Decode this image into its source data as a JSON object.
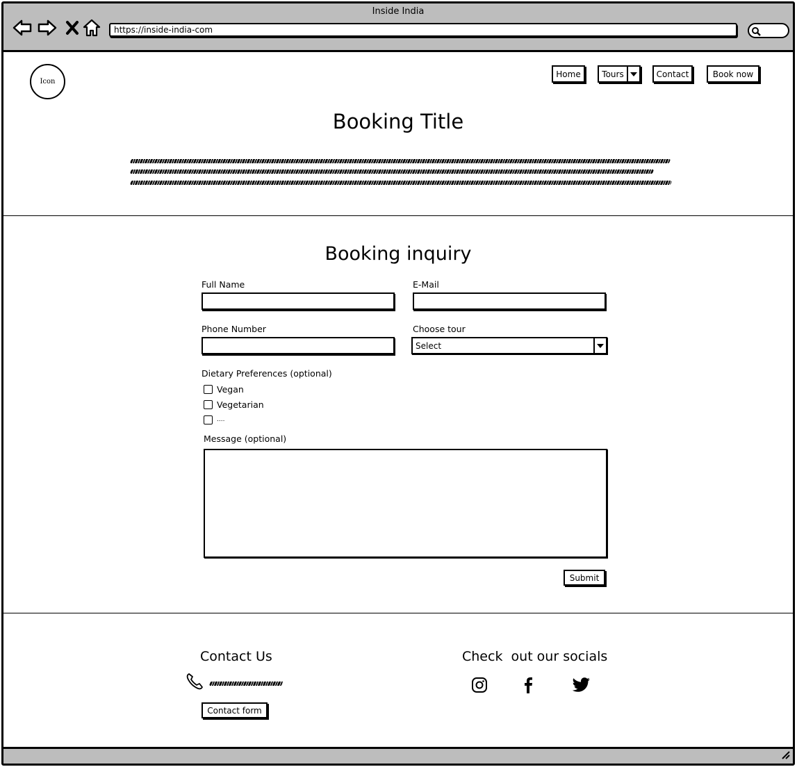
{
  "browser": {
    "title": "Inside India",
    "url": "https://inside-india-com",
    "icons": [
      "back-arrow-icon",
      "forward-arrow-icon",
      "close-x-icon",
      "home-icon",
      "search-icon"
    ]
  },
  "header": {
    "logo_label": "Icon",
    "nav": {
      "home": "Home",
      "tours": "Tours",
      "contact": "Contact",
      "book_now": "Book now"
    }
  },
  "hero": {
    "title": "Booking Title"
  },
  "form": {
    "heading": "Booking inquiry",
    "full_name_label": "Full Name",
    "email_label": "E-Mail",
    "phone_label": "Phone Number",
    "tour_label": "Choose tour",
    "tour_selected": "Select",
    "dietary_label": "Dietary Preferences (optional)",
    "dietary_options": [
      "Vegan",
      "Vegetarian",
      "...."
    ],
    "message_label": "Message (optional)",
    "submit_label": "Submit"
  },
  "footer": {
    "contact_heading": "Contact Us",
    "contact_button": "Contact form",
    "socials_heading": "Check  out our socials",
    "social_icons": [
      "instagram-icon",
      "facebook-icon",
      "twitter-icon"
    ]
  },
  "colors": {
    "chrome_gray": "#bdbdbd",
    "ink": "#000000",
    "background": "#ffffff"
  }
}
